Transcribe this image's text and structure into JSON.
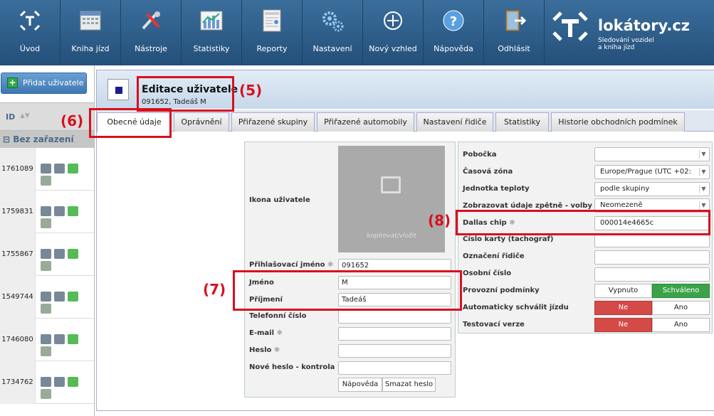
{
  "nav": [
    {
      "label": "Úvod",
      "icon": "home-logo-icon"
    },
    {
      "label": "Kniha jízd",
      "icon": "calendar-icon"
    },
    {
      "label": "Nástroje",
      "icon": "tools-icon"
    },
    {
      "label": "Statistiky",
      "icon": "chart-icon"
    },
    {
      "label": "Reporty",
      "icon": "report-icon"
    },
    {
      "label": "Nastavení",
      "icon": "gears-icon"
    },
    {
      "label": "Nový vzhled",
      "icon": "crosshair-icon"
    },
    {
      "label": "Nápověda",
      "icon": "help-icon"
    },
    {
      "label": "Odhlásit",
      "icon": "logout-door-icon"
    }
  ],
  "logo": {
    "brand": "lokátory.cz",
    "sub1": "Sledování vozidel",
    "sub2": "a kniha jízd"
  },
  "sidebar": {
    "add_button": "Přidat uživatele",
    "id_header": "ID",
    "group": "Bez zařazení",
    "rows": [
      "1761089",
      "1759831",
      "1755867",
      "1549744",
      "1746080",
      "1734762"
    ]
  },
  "header": {
    "title": "Editace uživatele",
    "subtitle": "091652, Tadeáš M"
  },
  "tabs": [
    "Obecné údaje",
    "Oprávnění",
    "Přiřazené skupiny",
    "Přiřazené automobily",
    "Nastavení řidiče",
    "Statistiky",
    "Historie obchodních podmínek"
  ],
  "annotations": {
    "a5": "(5)",
    "a6": "(6)",
    "a7": "(7)",
    "a8": "(8)"
  },
  "left_form": {
    "icon_label": "Ikona uživatele",
    "avatar_caption": "kopírovat/vložit",
    "login_label": "Přihlašovací jméno",
    "login_value": "091652",
    "first_label": "Jméno",
    "first_value": "M",
    "last_label": "Příjmení",
    "last_value": "Tadeáš",
    "phone_label": "Telefonní číslo",
    "email_label": "E-mail",
    "pass_label": "Heslo",
    "pass2_label": "Nové heslo - kontrola",
    "help_btn": "Nápověda",
    "clear_btn": "Smazat heslo"
  },
  "right_form": {
    "branch_label": "Pobočka",
    "tz_label": "Časová zóna",
    "tz_value": "Europe/Prague (UTC +02:",
    "temp_label": "Jednotka teploty",
    "temp_value": "podle skupiny",
    "history_label": "Zobrazovat údaje zpětně - volby",
    "history_value": "Neomezeně",
    "dallas_label": "Dallas chip",
    "dallas_value": "000014e4665c",
    "card_label": "Číslo karty (tachograf)",
    "driver_label": "Označení řidiče",
    "personal_label": "Osobní číslo",
    "conditions_label": "Provozní podmínky",
    "conditions_off": "Vypnuto",
    "conditions_on": "Schváleno",
    "auto_label": "Automaticky schválit jízdu",
    "test_label": "Testovací verze",
    "no": "Ne",
    "yes": "Ano"
  }
}
